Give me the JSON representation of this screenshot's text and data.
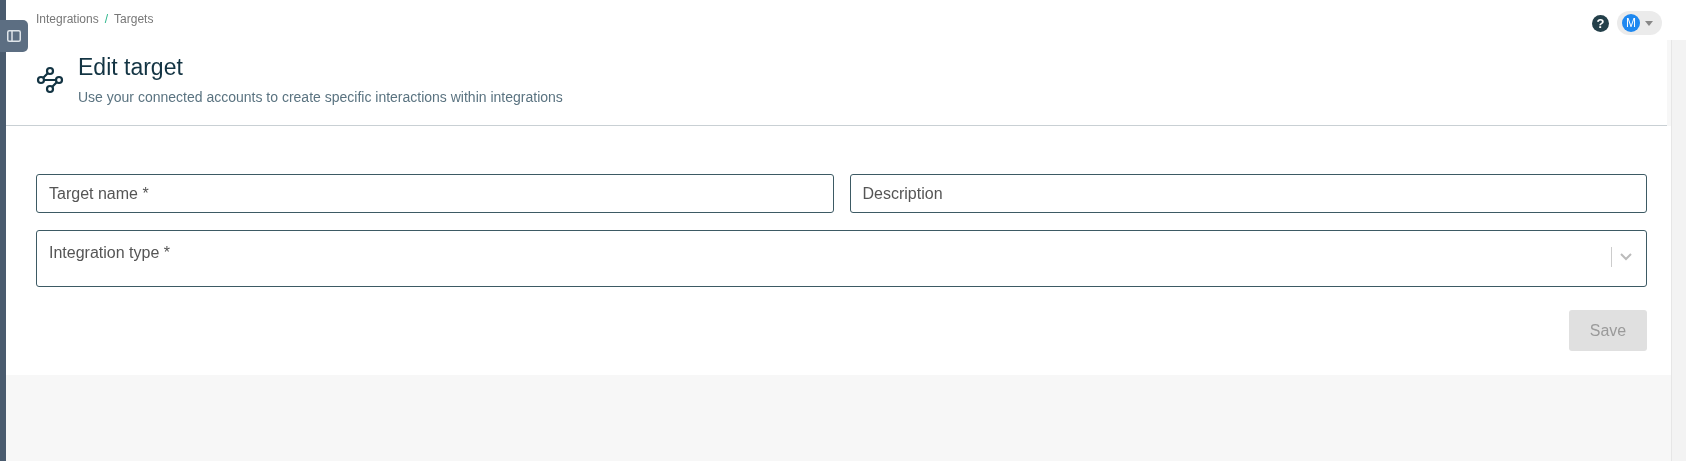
{
  "breadcrumb": [
    {
      "label": "Integrations"
    },
    {
      "label": "Targets"
    }
  ],
  "breadcrumb_separator": "/",
  "help": "?",
  "user": {
    "initial": "M"
  },
  "header": {
    "title": "Edit target",
    "subtitle": "Use your connected accounts to create specific interactions within integrations"
  },
  "fields": [
    {
      "kind": "text",
      "placeholder": "Target name *"
    },
    {
      "kind": "text",
      "placeholder": "Description"
    },
    {
      "kind": "select",
      "placeholder": "Integration type *"
    }
  ],
  "save_button": {
    "label": "Save",
    "disabled": true
  }
}
